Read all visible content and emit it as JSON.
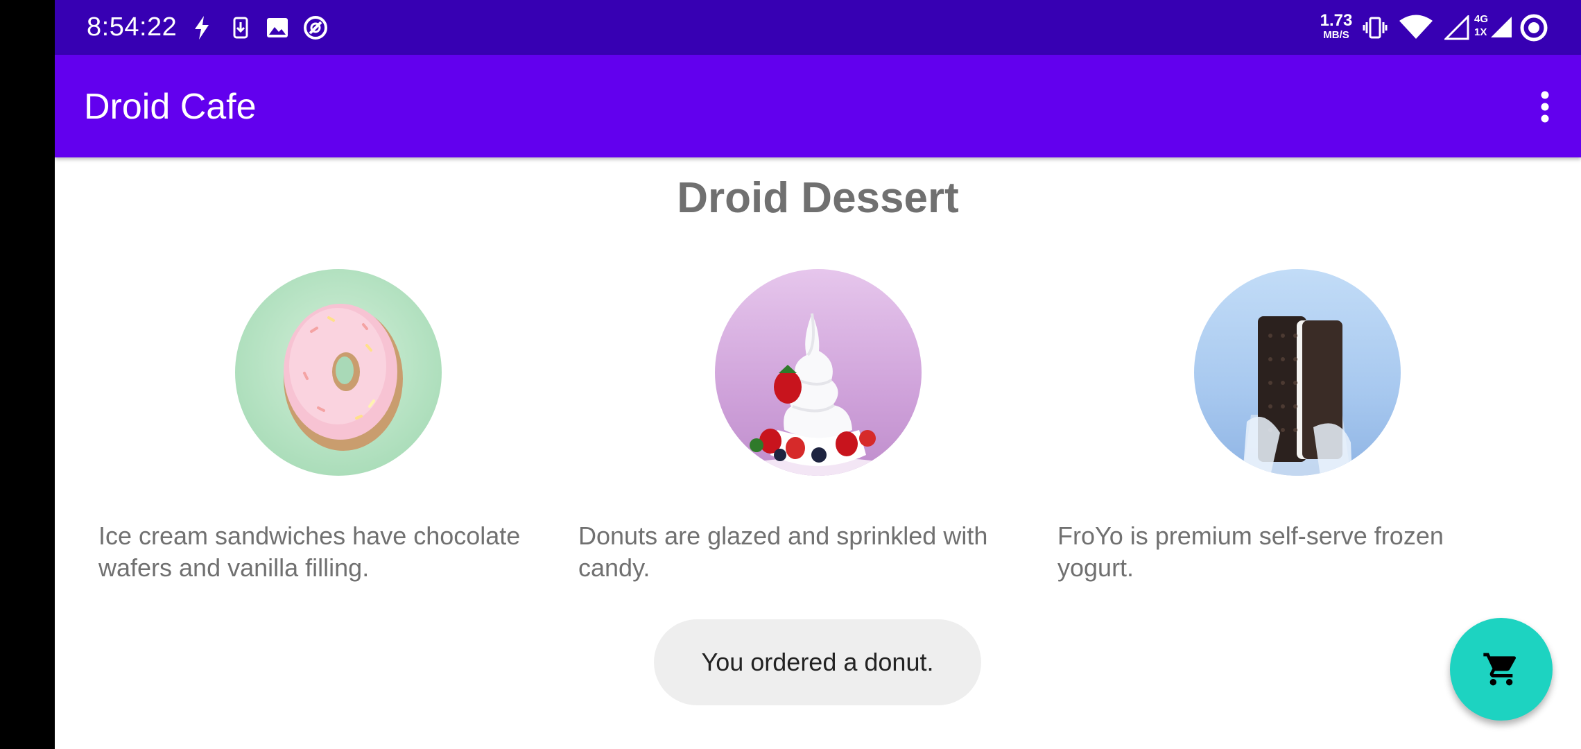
{
  "status_bar": {
    "time": "8:54:22",
    "net_speed_value": "1.73",
    "net_speed_unit": "MB/S",
    "network_badge_top": "4G",
    "network_badge_bottom": "1X",
    "left_icons": [
      "flash-icon",
      "download-icon",
      "image-icon",
      "app-notification-icon"
    ],
    "right_icons": [
      "vibrate-icon",
      "wifi-icon",
      "signal-icon",
      "signal-4g-icon",
      "hotspot-ring-icon"
    ]
  },
  "app_bar": {
    "title": "Droid Cafe",
    "menu_icon": "overflow-menu-icon"
  },
  "main": {
    "heading": "Droid Dessert",
    "items": [
      {
        "image": "donut-image",
        "description": "Ice cream sandwiches have chocolate wafers and vanilla filling."
      },
      {
        "image": "froyo-image",
        "description": "Donuts are glazed and sprinkled with candy."
      },
      {
        "image": "ice-cream-sandwich-image",
        "description": "FroYo is premium self-serve frozen yogurt."
      }
    ]
  },
  "toast": {
    "message": "You ordered a donut."
  },
  "fab": {
    "icon": "shopping-cart-icon",
    "color": "#1dd3c1"
  },
  "colors": {
    "status_bar": "#3700b3",
    "app_bar": "#6200ee",
    "text_secondary": "#707070"
  }
}
